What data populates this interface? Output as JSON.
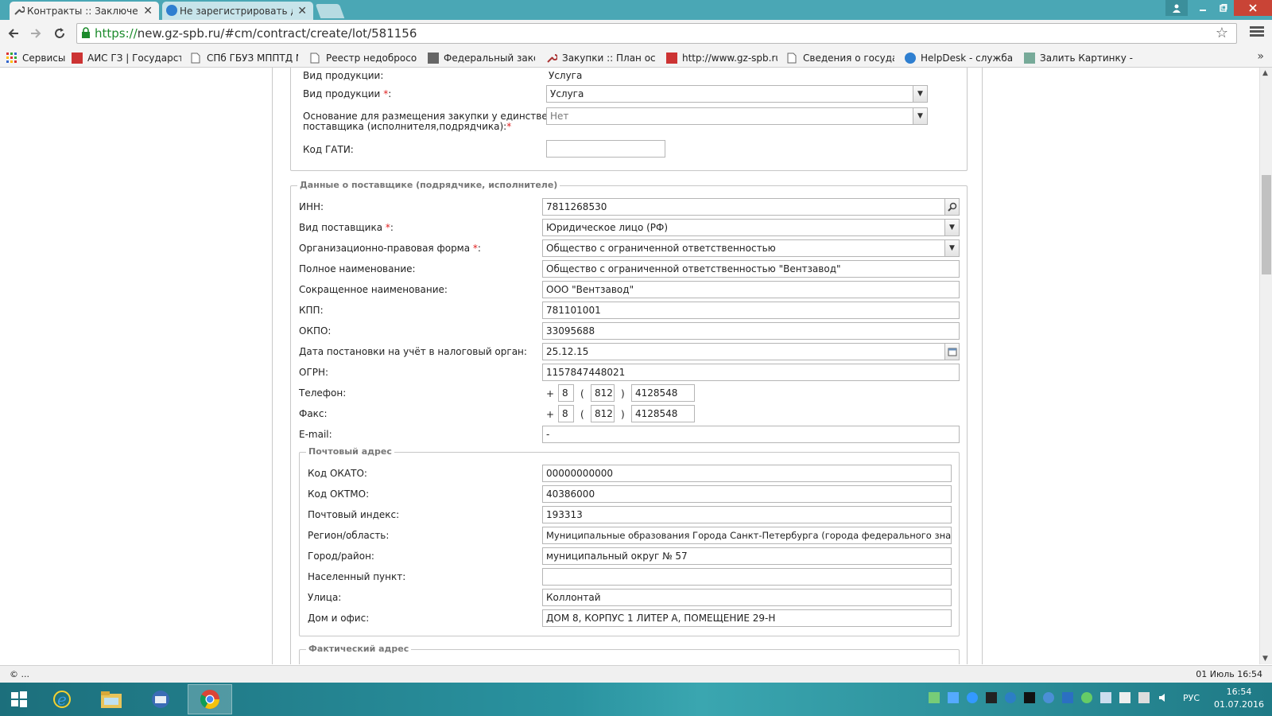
{
  "browser": {
    "tabs": [
      {
        "title": "Контракты :: Заключение",
        "close": "✕"
      },
      {
        "title": "Не зарегистрировать до",
        "close": "✕"
      }
    ],
    "url_scheme": "https://",
    "url_rest": "new.gz-spb.ru/#cm/contract/create/lot/581156",
    "bookmarks": [
      "Сервисы",
      "АИС ГЗ | Государстве",
      "СПб ГБУЗ МППТД N",
      "Реестр недобросове",
      "Федеральный закон",
      "Закупки :: План осущ",
      "http://www.gz-spb.ru/",
      "Сведения о государс",
      "HelpDesk - служба те",
      "Залить Картинку - За"
    ],
    "bookmarks_more": "»"
  },
  "product": {
    "vid_label_static": "Вид продукции:",
    "vid_value_static": "Услуга",
    "vid_label": "Вид продукции",
    "vid_value": "Услуга",
    "osnovanie_label_1": "Основание для размещения закупки у единственного",
    "osnovanie_label_2": "поставщика (исполнителя,подрядчика):",
    "osnovanie_value": "Нет",
    "gati_label": "Код ГАТИ:",
    "gati_value": ""
  },
  "supplier": {
    "legend": "Данные о поставщике (подрядчике, исполнителе)",
    "inn_label": "ИНН:",
    "inn_value": "7811268530",
    "vid_label": "Вид поставщика",
    "vid_value": "Юридическое лицо (РФ)",
    "opf_label": "Организационно-правовая форма",
    "opf_value": "Общество с ограниченной ответственностью",
    "full_name_label": "Полное наименование:",
    "full_name_value": "Общество с ограниченной ответственностью \"Вентзавод\"",
    "short_name_label": "Сокращенное наименование:",
    "short_name_value": "ООО \"Вентзавод\"",
    "kpp_label": "КПП:",
    "kpp_value": "781101001",
    "okpo_label": "ОКПО:",
    "okpo_value": "33095688",
    "tax_date_label": "Дата постановки на учёт в налоговый орган:",
    "tax_date_value": "25.12.15",
    "ogrn_label": "ОГРН:",
    "ogrn_value": "1157847448021",
    "phone_label": "Телефон:",
    "phone": {
      "plus": "+",
      "country": "8",
      "lpar": "(",
      "code": "812",
      "rpar": ")",
      "number": "4128548"
    },
    "fax_label": "Факс:",
    "fax": {
      "plus": "+",
      "country": "8",
      "lpar": "(",
      "code": "812",
      "rpar": ")",
      "number": "4128548"
    },
    "email_label": "E-mail:",
    "email_value": "-",
    "required_mark": "*"
  },
  "postal": {
    "legend": "Почтовый адрес",
    "okato_label": "Код ОКАТО:",
    "okato_value": "00000000000",
    "oktmo_label": "Код ОКТМО:",
    "oktmo_value": "40386000",
    "index_label": "Почтовый индекс:",
    "index_value": "193313",
    "region_label": "Регион/область:",
    "region_value": "Муниципальные образования Города Санкт-Петербурга (города федерального значения)",
    "city_label": "Город/район:",
    "city_value": "муниципальный округ № 57",
    "settlement_label": "Населенный пункт:",
    "settlement_value": "",
    "street_label": "Улица:",
    "street_value": "Коллонтай",
    "house_label": "Дом и офис:",
    "house_value": "ДОМ 8, КОРПУС 1 ЛИТЕР А, ПОМЕЩЕНИЕ 29-Н"
  },
  "actual": {
    "legend": "Фактический адрес"
  },
  "status": {
    "left": "© ...",
    "right": "01 Июль 16:54"
  },
  "taskbar": {
    "lang": "РУС",
    "time": "16:54",
    "date": "01.07.2016"
  },
  "colors": {
    "tabbar": "#4aa7b5",
    "required": "#e02020",
    "https": "#1c8b2c"
  }
}
